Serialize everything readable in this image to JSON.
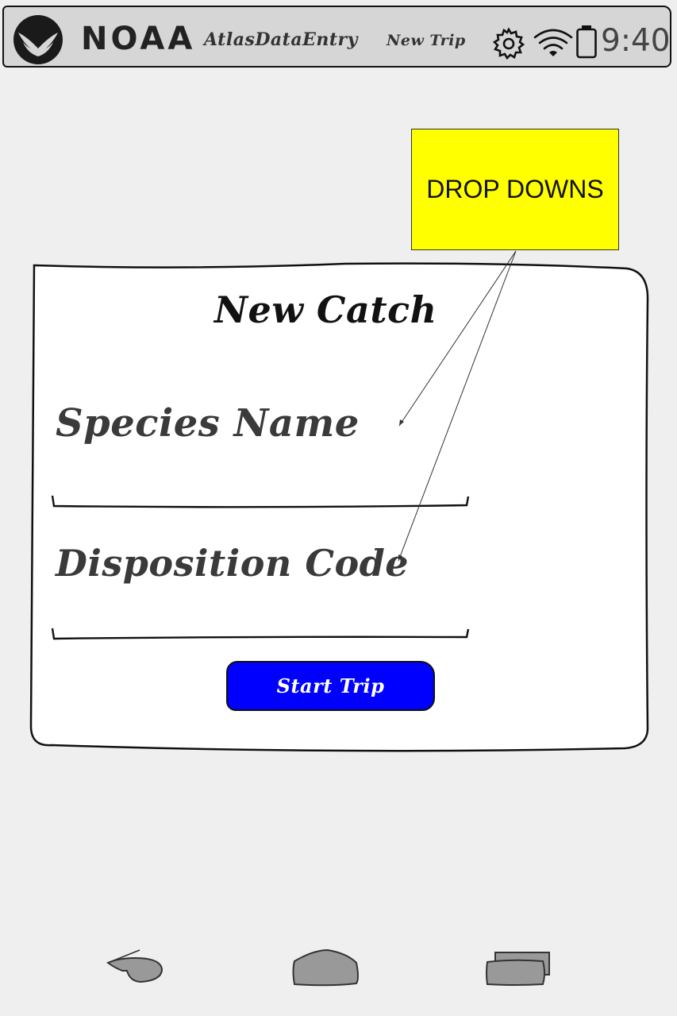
{
  "status_bar": {
    "brand": "NOAA",
    "app_title": "AtlasDataEntry",
    "screen_title": "New Trip",
    "time": "9:40",
    "icons": [
      "noaa-logo",
      "gear-icon",
      "wifi-icon",
      "battery-icon"
    ]
  },
  "annotation": {
    "note_text": "DROP DOWNS",
    "note_color": "#ffff00"
  },
  "form": {
    "title": "New Catch",
    "species_label": "Species Name",
    "species_value": "",
    "disposition_label": "Disposition Code",
    "disposition_value": "",
    "submit_label": "Start Trip",
    "submit_color": "#0000ff"
  },
  "nav_bar": {
    "icons": [
      "back-icon",
      "home-icon",
      "recents-icon"
    ]
  }
}
